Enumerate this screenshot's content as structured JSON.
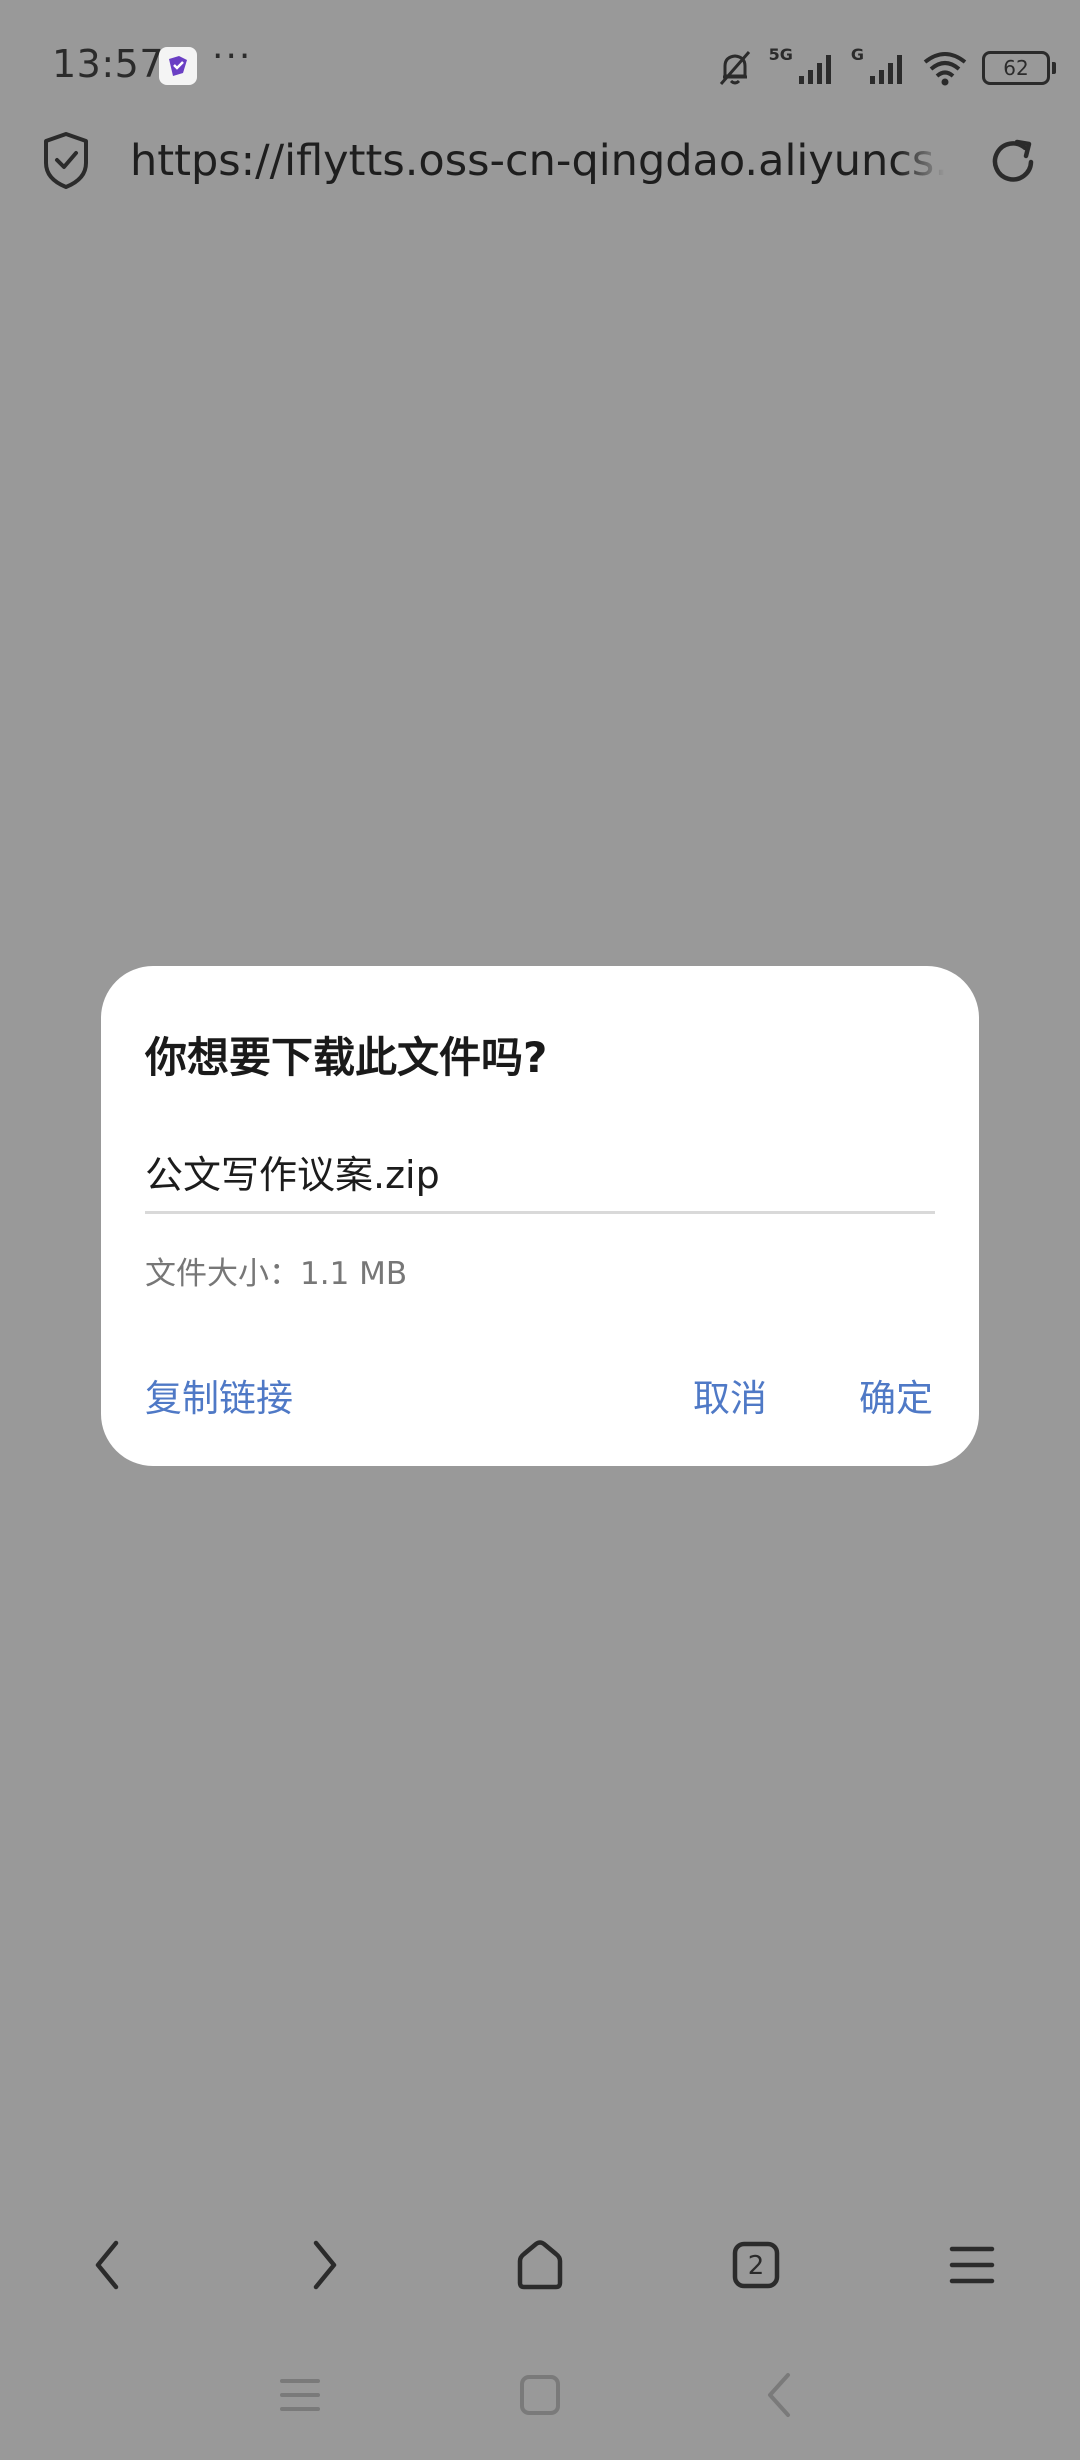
{
  "status_bar": {
    "time": "13:57",
    "more": "···",
    "network_label_1": "5G",
    "network_label_2": "G",
    "battery_level": "62",
    "icons": [
      "app-badge-icon",
      "mute-bell-icon",
      "signal-5g-icon",
      "signal-g-icon",
      "wifi-icon",
      "battery-icon"
    ]
  },
  "address_bar": {
    "url": "https://iflytts.oss-cn-qingdao.aliyuncs.com/",
    "icons": [
      "security-shield-icon",
      "reload-icon"
    ]
  },
  "dialog": {
    "title": "你想要下载此文件吗?",
    "filename": "公文写作议案.zip",
    "file_size": "文件大小：1.1 MB",
    "buttons": {
      "copy_link": "复制链接",
      "cancel": "取消",
      "confirm": "确定"
    }
  },
  "toolbar": {
    "tab_count": "2",
    "icons": [
      "back-icon",
      "forward-icon",
      "home-icon",
      "tabs-icon",
      "menu-icon"
    ]
  },
  "system_nav": {
    "icons": [
      "recents-icon",
      "home-nav-icon",
      "back-nav-icon"
    ]
  },
  "colors": {
    "scrim_background": "#999999",
    "dialog_background": "#ffffff",
    "accent_blue": "#4f79c6",
    "icon_dark": "#2b2b2b"
  }
}
